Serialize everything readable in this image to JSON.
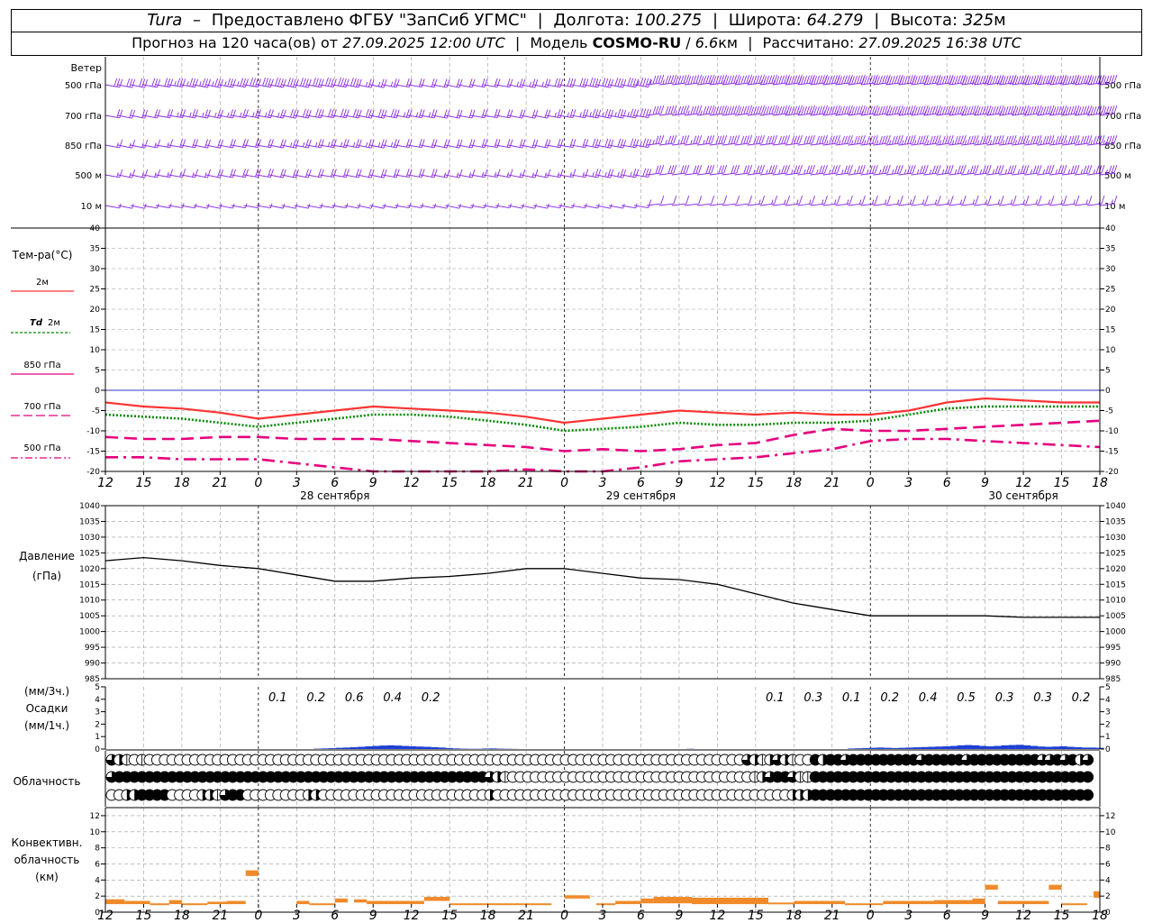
{
  "header": {
    "station": "Tura",
    "provider": "Предоставлено ФГБУ \"ЗапСиб УГМС\"",
    "lon_label": "Долгота:",
    "lon": "100.275",
    "lat_label": "Широта:",
    "lat": "64.279",
    "alt_label": "Высота:",
    "alt": "325",
    "alt_unit": "м",
    "forecast_label": "Прогноз на 120 часа(ов) от",
    "forecast_from": "27.09.2025 12:00 UTC",
    "model_label": "Модель",
    "model": "COSMO-RU",
    "resolution": "6.6",
    "res_unit": "км",
    "calc_label": "Рассчитано:",
    "calc_time": "27.09.2025 16:38 UTC"
  },
  "labels": {
    "wind": "Ветер",
    "wind_levels": [
      "500 гПа",
      "700 гПа",
      "850 гПа",
      "500 м",
      "10 м"
    ],
    "temp": "Тем-ра(°C)",
    "t2m": "2м",
    "td_prefix": "Td",
    "td_suffix": "2м",
    "t850": "850 гПа",
    "t700": "700 гПа",
    "t500": "500 гПа",
    "pressure": "Давление",
    "pressure_unit": "(гПа)",
    "precip_top": "(мм/3ч.)",
    "precip": "Осадки",
    "precip_bottom": "(мм/1ч.)",
    "cloud": "Облачность",
    "conv1": "Конвективн.",
    "conv2": "облачность",
    "conv3": "(км)"
  },
  "colors": {
    "t2m": "#ff3333",
    "td": "#008800",
    "t850": "#e6007e",
    "t700": "#e6007e",
    "t500": "#e6007e",
    "pressure": "#000000",
    "precip": "#1f3fd6",
    "conv": "#f08a2a",
    "wind": "#8a2be2",
    "zero": "#3333cc"
  },
  "chart_data": {
    "type": "line",
    "x_ticks": [
      "12",
      "15",
      "18",
      "21",
      "0",
      "3",
      "6",
      "9",
      "12",
      "15",
      "18",
      "21",
      "0",
      "3",
      "6",
      "9",
      "12",
      "15",
      "18",
      "21",
      "0",
      "3",
      "6",
      "9",
      "12",
      "15",
      "18"
    ],
    "day_labels": [
      "28 сентября",
      "29 сентября",
      "30 сентября"
    ],
    "hours": [
      0,
      3,
      6,
      9,
      12,
      15,
      18,
      21,
      24,
      27,
      30,
      33,
      36,
      39,
      42,
      45,
      48,
      51,
      54,
      57,
      60,
      63,
      66,
      69,
      72,
      75,
      78
    ],
    "temperature": {
      "ylim": [
        -20,
        40
      ],
      "ticks": [
        40,
        35,
        30,
        25,
        20,
        15,
        10,
        5,
        0,
        -5,
        -10,
        -15,
        -20
      ],
      "series": [
        {
          "name": "2м",
          "values": [
            -3,
            -4,
            -4.5,
            -5.5,
            -7,
            -6,
            -5,
            -4,
            -4.5,
            -5,
            -5.5,
            -6.5,
            -8,
            -7,
            -6,
            -5,
            -5.5,
            -6,
            -5.5,
            -6,
            -6,
            -5,
            -3,
            -2,
            -2.5,
            -3,
            -3
          ]
        },
        {
          "name": "Td 2м",
          "values": [
            -6,
            -6.5,
            -7,
            -8,
            -9,
            -8,
            -7,
            -6,
            -6,
            -6.5,
            -7.5,
            -8.5,
            -10,
            -9.5,
            -9,
            -8,
            -8.5,
            -8.5,
            -8,
            -8,
            -7.5,
            -6,
            -4.5,
            -4,
            -4,
            -4,
            -4
          ]
        },
        {
          "name": "850 гПа",
          "values": [
            -11.5,
            -12,
            -12,
            -11.5,
            -11.5,
            -12,
            -12,
            -12,
            -12.5,
            -13,
            -13.5,
            -14,
            -15,
            -14.5,
            -15,
            -14.5,
            -13.5,
            -13,
            -11,
            -9.5,
            -10,
            -10,
            -9.5,
            -9,
            -8.5,
            -8,
            -7.5
          ]
        },
        {
          "name": "700 гПа",
          "values": [
            -16.5,
            -16.5,
            -17,
            -17,
            -17,
            -18,
            -19,
            -20.5,
            -21,
            -21,
            -20,
            -19.5,
            -20,
            -20,
            -19,
            -17.5,
            -17,
            -16.5,
            -15.5,
            -14.5,
            -12.5,
            -12,
            -12,
            -12.5,
            -13,
            -13.5,
            -14
          ]
        }
      ]
    },
    "pressure": {
      "ylim": [
        985,
        1040
      ],
      "ticks": [
        1040,
        1035,
        1030,
        1025,
        1020,
        1015,
        1010,
        1005,
        1000,
        995,
        990,
        985
      ],
      "values": [
        1022.5,
        1023.5,
        1022.5,
        1021,
        1020,
        1018,
        1016,
        1016,
        1017,
        1017.5,
        1018.5,
        1020,
        1020,
        1018.5,
        1017,
        1016.5,
        1015,
        1012,
        1009,
        1007,
        1005,
        1005,
        1005,
        1005,
        1004.5,
        1004.5,
        1004.5
      ]
    },
    "precipitation": {
      "ylim": [
        0,
        5
      ],
      "ticks": [
        5,
        4,
        3,
        2,
        1,
        0
      ],
      "labels_3h": [
        "0.1",
        "0.2",
        "0.6",
        "0.4",
        "0.2",
        "0.1",
        "0.3",
        "0.1",
        "0.2",
        "0.4",
        "0.5",
        "0.3",
        "0.3",
        "0.2"
      ],
      "labels_hours": [
        15,
        18,
        21,
        24,
        27,
        54,
        57,
        60,
        63,
        66,
        69,
        72,
        75,
        78
      ],
      "hourly": [
        0,
        0,
        0,
        0,
        0,
        0,
        0,
        0,
        0,
        0,
        0,
        0,
        0,
        0,
        0,
        0,
        0,
        0,
        0,
        0,
        0,
        0,
        0,
        0,
        0,
        0,
        0,
        0,
        0,
        0.03,
        0.05,
        0.07,
        0.1,
        0.12,
        0.15,
        0.18,
        0.22,
        0.25,
        0.28,
        0.3,
        0.28,
        0.25,
        0.22,
        0.2,
        0.18,
        0.15,
        0.12,
        0.08,
        0.05,
        0.03,
        0.02,
        0.02,
        0.04,
        0.05,
        0.03,
        0.02,
        0.01,
        0,
        0,
        0,
        0,
        0,
        0,
        0,
        0,
        0,
        0,
        0,
        0,
        0,
        0,
        0,
        0,
        0,
        0,
        0,
        0,
        0,
        0,
        0,
        0.02,
        0,
        0,
        0,
        0,
        0,
        0,
        0,
        0,
        0,
        0,
        0,
        0,
        0,
        0,
        0,
        0,
        0,
        0,
        0,
        0,
        0,
        0.04,
        0.06,
        0.08,
        0.1,
        0.12,
        0.1,
        0.08,
        0.1,
        0.12,
        0.14,
        0.16,
        0.18,
        0.2,
        0.22,
        0.25,
        0.3,
        0.32,
        0.3,
        0.25,
        0.22,
        0.25,
        0.3,
        0.32,
        0.34,
        0.3,
        0.25,
        0.2,
        0.18,
        0.2,
        0.22,
        0.18,
        0.15,
        0.12,
        0.12,
        0.1
      ]
    },
    "cloudiness": {
      "rows": [
        {
          "name": "upper",
          "values": [
            3,
            2,
            1,
            0,
            1,
            0,
            0,
            0,
            0,
            0,
            0,
            0,
            0,
            0,
            0,
            0,
            0,
            0,
            0,
            0,
            0,
            0,
            0,
            0,
            0,
            0,
            0,
            0,
            0,
            0,
            0,
            0,
            0,
            0,
            0,
            0,
            0,
            0,
            0,
            0,
            0,
            0,
            0,
            0,
            0,
            0,
            0,
            0,
            0,
            0,
            0,
            0,
            0,
            0,
            0,
            0,
            0,
            0,
            0,
            0,
            0,
            0,
            0,
            0,
            0,
            0,
            0,
            0,
            0,
            0,
            0,
            0,
            0,
            0,
            0,
            0,
            0,
            0,
            0,
            0,
            0,
            0,
            0,
            0,
            3,
            2,
            1,
            2,
            3,
            2,
            1,
            0,
            0,
            4,
            2,
            4,
            4,
            3,
            4,
            4,
            4,
            4,
            4,
            4,
            4,
            4,
            4,
            3,
            4,
            4,
            4,
            4,
            4,
            3,
            4,
            4,
            4,
            4,
            4,
            4,
            4,
            4,
            4,
            3,
            3,
            4,
            3,
            4,
            2,
            3
          ]
        },
        {
          "name": "middle",
          "values": [
            3,
            4,
            4,
            4,
            4,
            4,
            4,
            4,
            4,
            4,
            4,
            4,
            4,
            4,
            4,
            4,
            4,
            4,
            4,
            4,
            4,
            4,
            4,
            4,
            4,
            4,
            4,
            4,
            4,
            4,
            4,
            4,
            4,
            4,
            4,
            4,
            4,
            4,
            4,
            4,
            4,
            4,
            4,
            4,
            4,
            4,
            4,
            4,
            4,
            4,
            3,
            2,
            1,
            0,
            0,
            0,
            0,
            0,
            0,
            0,
            0,
            0,
            0,
            0,
            0,
            0,
            0,
            0,
            0,
            0,
            0,
            0,
            0,
            0,
            0,
            0,
            0,
            0,
            0,
            0,
            0,
            0,
            0,
            0,
            0,
            1,
            2,
            3,
            4,
            4,
            3,
            1,
            1,
            4,
            4,
            4,
            4,
            4,
            4,
            4,
            4,
            4,
            4,
            4,
            4,
            4,
            4,
            4,
            4,
            4,
            4,
            4,
            4,
            4,
            4,
            4,
            4,
            4,
            4,
            4,
            4,
            4,
            4,
            4,
            4,
            4,
            4,
            4,
            4,
            4
          ]
        },
        {
          "name": "low",
          "values": [
            0,
            0,
            2,
            2,
            4,
            4,
            4,
            4,
            0,
            0,
            0,
            0,
            2,
            2,
            1,
            3,
            4,
            4,
            0,
            0,
            0,
            0,
            0,
            0,
            0,
            0,
            2,
            2,
            0,
            0,
            0,
            0,
            0,
            0,
            0,
            0,
            0,
            0,
            0,
            0,
            0,
            0,
            0,
            0,
            0,
            0,
            0,
            0,
            0,
            0,
            2,
            0,
            0,
            0,
            0,
            0,
            0,
            0,
            0,
            0,
            0,
            0,
            0,
            0,
            0,
            0,
            0,
            0,
            0,
            0,
            0,
            0,
            0,
            0,
            0,
            0,
            0,
            0,
            0,
            0,
            0,
            0,
            0,
            0,
            0,
            0,
            0,
            0,
            0,
            0,
            2,
            2,
            2,
            4,
            4,
            4,
            4,
            4,
            4,
            4,
            4,
            4,
            4,
            4,
            4,
            4,
            4,
            4,
            4,
            4,
            4,
            4,
            4,
            4,
            4,
            4,
            4,
            4,
            4,
            4,
            4,
            4,
            4,
            4,
            4,
            4,
            4,
            4,
            4,
            4
          ]
        }
      ]
    },
    "convective": {
      "ylim": [
        0,
        13
      ],
      "ticks": [
        12,
        10,
        8,
        6,
        4,
        2,
        0
      ],
      "segments": [
        {
          "h0": 0,
          "h1": 1.5,
          "bottom": 1,
          "top": 1.6
        },
        {
          "h0": 1.5,
          "h1": 3.5,
          "bottom": 1,
          "top": 1.4
        },
        {
          "h0": 3.5,
          "h1": 5,
          "bottom": 1,
          "top": 1.1
        },
        {
          "h0": 5,
          "h1": 6,
          "bottom": 1,
          "top": 1.5
        },
        {
          "h0": 6,
          "h1": 8,
          "bottom": 1,
          "top": 1.1
        },
        {
          "h0": 8,
          "h1": 9.5,
          "bottom": 1,
          "top": 1.3
        },
        {
          "h0": 9.5,
          "h1": 11,
          "bottom": 1,
          "top": 1.4
        },
        {
          "h0": 11,
          "h1": 12,
          "bottom": 4.5,
          "top": 5.2
        },
        {
          "h0": 15,
          "h1": 16,
          "bottom": 1,
          "top": 1.4
        },
        {
          "h0": 16,
          "h1": 18,
          "bottom": 1,
          "top": 1.1
        },
        {
          "h0": 18,
          "h1": 19,
          "bottom": 1.2,
          "top": 1.7
        },
        {
          "h0": 19.5,
          "h1": 20.5,
          "bottom": 1.2,
          "top": 1.6
        },
        {
          "h0": 20.5,
          "h1": 25,
          "bottom": 1,
          "top": 1.4
        },
        {
          "h0": 25,
          "h1": 27,
          "bottom": 1.4,
          "top": 1.9
        },
        {
          "h0": 27,
          "h1": 35,
          "bottom": 1,
          "top": 1.1
        },
        {
          "h0": 36,
          "h1": 38,
          "bottom": 1.7,
          "top": 2.1
        },
        {
          "h0": 38.5,
          "h1": 40,
          "bottom": 1,
          "top": 1.1
        },
        {
          "h0": 40,
          "h1": 42,
          "bottom": 1,
          "top": 1.4
        },
        {
          "h0": 42,
          "h1": 43,
          "bottom": 1.1,
          "top": 1.7
        },
        {
          "h0": 43,
          "h1": 46,
          "bottom": 1.1,
          "top": 1.9
        },
        {
          "h0": 46,
          "h1": 52,
          "bottom": 1,
          "top": 1.8
        },
        {
          "h0": 52,
          "h1": 54,
          "bottom": 1,
          "top": 1.2
        },
        {
          "h0": 54,
          "h1": 58,
          "bottom": 1,
          "top": 1.4
        },
        {
          "h0": 58,
          "h1": 61,
          "bottom": 1,
          "top": 1.1
        },
        {
          "h0": 61,
          "h1": 65,
          "bottom": 1,
          "top": 1.4
        },
        {
          "h0": 65,
          "h1": 68,
          "bottom": 1,
          "top": 1.5
        },
        {
          "h0": 68,
          "h1": 69,
          "bottom": 1,
          "top": 1.7
        },
        {
          "h0": 69,
          "h1": 70,
          "bottom": 2.8,
          "top": 3.4
        },
        {
          "h0": 70,
          "h1": 74,
          "bottom": 1,
          "top": 1.4
        },
        {
          "h0": 74,
          "h1": 75,
          "bottom": 2.8,
          "top": 3.4
        },
        {
          "h0": 75,
          "h1": 77,
          "bottom": 1,
          "top": 1.1
        },
        {
          "h0": 77.5,
          "h1": 78,
          "bottom": 1.8,
          "top": 2.6
        }
      ]
    },
    "wind_speed_kt": {
      "500 гПа": [
        30,
        30,
        35,
        35,
        40,
        40,
        40,
        25,
        20,
        20,
        20,
        25,
        30,
        40,
        45,
        50,
        55,
        55,
        60,
        60,
        60,
        60,
        60,
        65,
        65,
        65,
        65
      ],
      "700 гПа": [
        20,
        20,
        25,
        25,
        25,
        30,
        30,
        30,
        25,
        20,
        20,
        20,
        25,
        35,
        40,
        45,
        50,
        50,
        55,
        55,
        55,
        55,
        55,
        55,
        55,
        55,
        55
      ],
      "850 гПа": [
        15,
        15,
        20,
        20,
        20,
        25,
        25,
        25,
        20,
        20,
        20,
        20,
        20,
        30,
        35,
        35,
        40,
        40,
        40,
        45,
        45,
        45,
        45,
        45,
        45,
        45,
        45
      ],
      "500 м": [
        15,
        15,
        15,
        20,
        20,
        20,
        20,
        20,
        20,
        15,
        15,
        15,
        15,
        25,
        30,
        30,
        30,
        35,
        35,
        35,
        35,
        35,
        35,
        35,
        35,
        35,
        35
      ],
      "10 м": [
        5,
        5,
        5,
        5,
        5,
        5,
        5,
        5,
        5,
        5,
        5,
        5,
        5,
        5,
        10,
        10,
        10,
        15,
        15,
        15,
        15,
        15,
        15,
        15,
        15,
        15,
        15
      ]
    }
  }
}
